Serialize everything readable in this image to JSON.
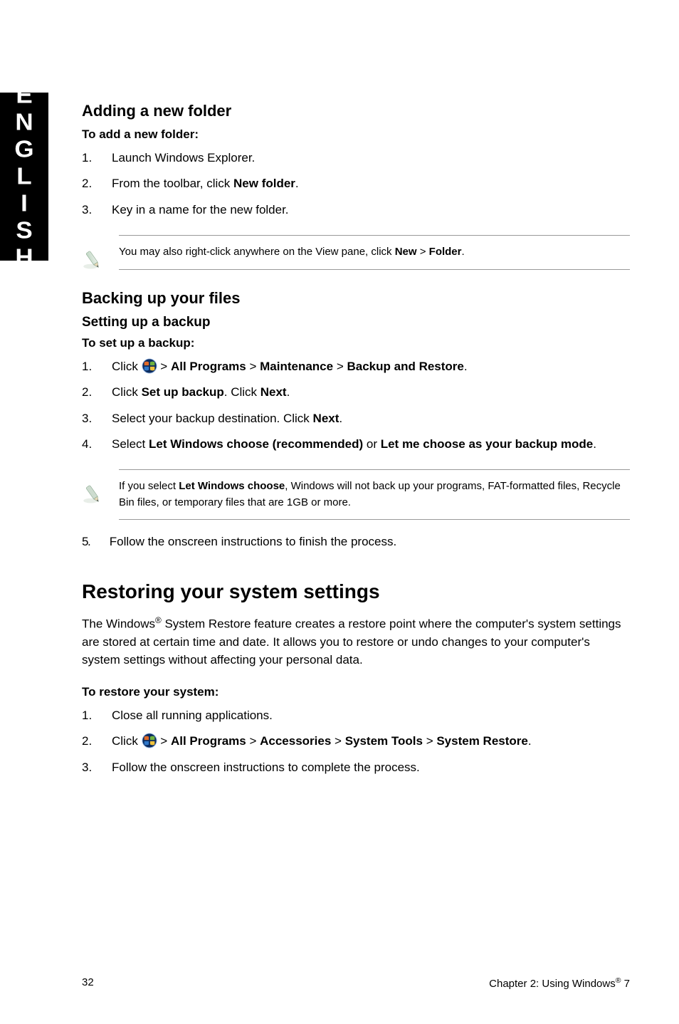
{
  "sideTab": "ENGLISH",
  "section_add_folder": {
    "heading": "Adding a new folder",
    "lead": "To add a new folder:",
    "steps": [
      "Launch Windows Explorer.",
      "From the toolbar, click <b>New folder</b>.",
      "Key in a name for the new folder."
    ],
    "note": "You may also right-click anywhere on the View pane, click <b>New</b> > <b>Folder</b>."
  },
  "section_backup": {
    "heading": "Backing up your files",
    "sub_heading": "Setting up a backup",
    "lead": "To set up a backup:",
    "steps_a": [
      "Click {WIN} > <b>All Programs</b> > <b>Maintenance</b> > <b>Backup and Restore</b>.",
      "Click <b>Set up backup</b>. Click <b>Next</b>.",
      "Select your backup destination. Click <b>Next</b>.",
      "Select <b>Let Windows choose (recommended)</b> or <b>Let me choose as your backup mode</b>."
    ],
    "note": "If you select <b>Let Windows choose</b>, Windows will not back up your programs, FAT-formatted files, Recycle Bin files, or temporary files that are 1GB or more.",
    "steps_b_start": 5,
    "steps_b": [
      "Follow the onscreen instructions to finish the process."
    ]
  },
  "section_restore": {
    "heading": "Restoring your system settings",
    "intro": "The Windows<span class=\"sup\">&reg;</span> System Restore feature creates a restore point where the computer's system settings are stored at certain time and date. It allows you to restore or undo changes to your computer's system settings without affecting your personal data.",
    "lead": "To restore your system:",
    "steps": [
      "Close all running applications.",
      "Click {WIN} > <b>All Programs</b> > <b>Accessories</b> > <b>System Tools</b> > <b>System Restore</b>.",
      "Follow the onscreen instructions to complete the process."
    ]
  },
  "footer": {
    "page": "32",
    "chapter": "Chapter 2: Using Windows<span class=\"sup\">&reg;</span> 7"
  }
}
